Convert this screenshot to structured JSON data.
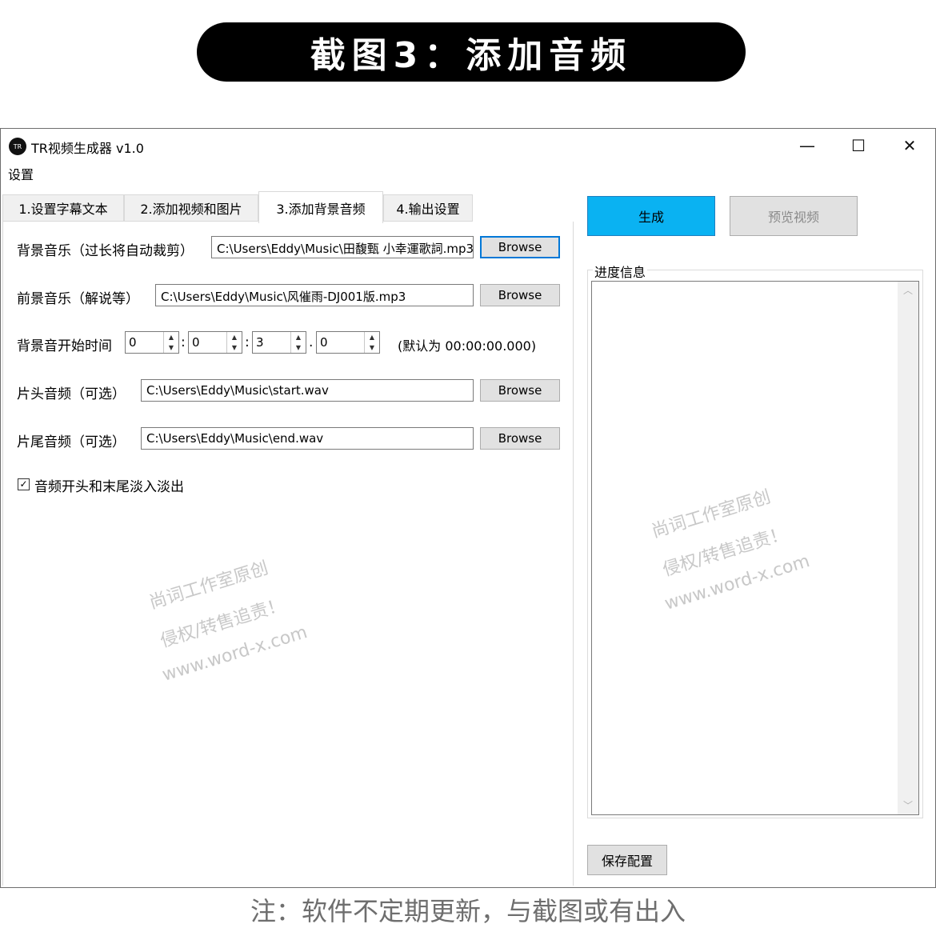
{
  "banner": {
    "text": "截图3：添加音频"
  },
  "window": {
    "title": "TR视频生成器 v1.0",
    "icon_text": "TR",
    "controls": {
      "minimize": "—",
      "maximize": "☐",
      "close": "✕"
    }
  },
  "menu": {
    "settings": "设置"
  },
  "tabs": [
    {
      "label": "1.设置字幕文本"
    },
    {
      "label": "2.添加视频和图片"
    },
    {
      "label": "3.添加背景音频"
    },
    {
      "label": "4.输出设置"
    }
  ],
  "form": {
    "bg_music": {
      "label": "背景音乐（过长将自动裁剪）",
      "value": "C:\\Users\\Eddy\\Music\\田馥甄  小幸運歌詞.mp3",
      "button": "Browse"
    },
    "fg_music": {
      "label": "前景音乐（解说等）",
      "value": "C:\\Users\\Eddy\\Music\\风催雨-DJ001版.mp3",
      "button": "Browse"
    },
    "start_time": {
      "label": "背景音开始时间",
      "h": "0",
      "m": "0",
      "s": "3",
      "ms": "0",
      "sep1": ":",
      "sep2": ":",
      "sep3": ".",
      "hint": "(默认为 00:00:00.000)"
    },
    "intro": {
      "label": "片头音频（可选）",
      "value": "C:\\Users\\Eddy\\Music\\start.wav",
      "button": "Browse"
    },
    "outro": {
      "label": "片尾音频（可选）",
      "value": "C:\\Users\\Eddy\\Music\\end.wav",
      "button": "Browse"
    },
    "fade": {
      "label": "音频开头和末尾淡入淡出",
      "checked": "✓"
    }
  },
  "right": {
    "generate": "生成",
    "preview": "预览视频",
    "progress_title": "进度信息",
    "scroll_up": "︿",
    "scroll_down": "﹀",
    "save": "保存配置"
  },
  "watermark": {
    "line1": "尚词工作室原创",
    "line2": "侵权/转售追责！",
    "line3": "www.word-x.com"
  },
  "footnote": "注：软件不定期更新，与截图或有出入"
}
